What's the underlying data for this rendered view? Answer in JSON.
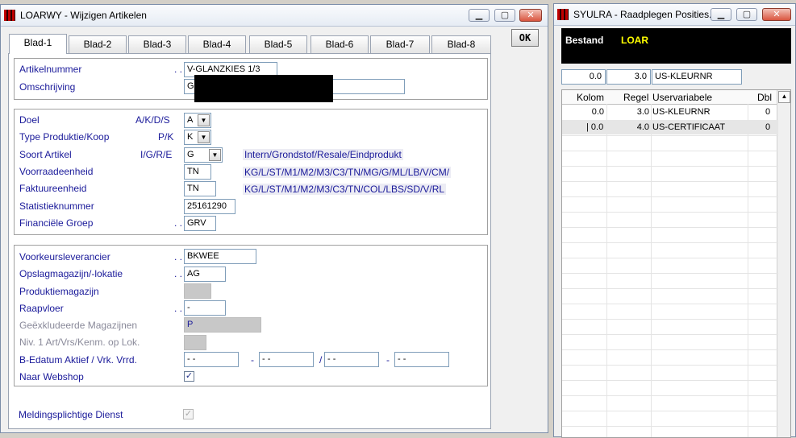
{
  "main_window": {
    "title": "LOARWY - Wijzigen Artikelen",
    "ok_label": "OK",
    "tabs": [
      {
        "label": "Blad-1"
      },
      {
        "label": "Blad-2"
      },
      {
        "label": "Blad-3"
      },
      {
        "label": "Blad-4"
      },
      {
        "label": "Blad-5"
      },
      {
        "label": "Blad-6"
      },
      {
        "label": "Blad-7"
      },
      {
        "label": "Blad-8"
      }
    ],
    "active_tab": "Blad-1",
    "group1": {
      "artikelnummer_label": "Artikelnummer",
      "artikelnummer_value": "V-GLANZKIES 1/3",
      "omschrijving_label": "Omschrijving",
      "omschrijving_value": "G"
    },
    "group2": {
      "doel_label": "Doel",
      "doel_codes": "A/K/D/S",
      "doel_value": "A",
      "type_label": "Type Produktie/Koop",
      "type_codes": "P/K",
      "type_value": "K",
      "soort_label": "Soort Artikel",
      "soort_codes": "I/G/R/E",
      "soort_value": "G",
      "soort_hint": "Intern/Grondstof/Resale/Eindprodukt",
      "voorraad_label": "Voorraadeenheid",
      "voorraad_value": "TN",
      "voorraad_hint": "KG/L/ST/M1/M2/M3/C3/TN/MG/G/ML/LB/V/CM/",
      "faktuur_label": "Faktuureenheid",
      "faktuur_value": "TN",
      "faktuur_hint": "KG/L/ST/M1/M2/M3/C3/TN/COL/LBS/SD/V/RL",
      "statistiek_label": "Statistieknummer",
      "statistiek_value": "25161290",
      "financiele_label": "Financiële Groep",
      "financiele_value": "GRV"
    },
    "group3": {
      "voorkeur_label": "Voorkeursleverancier",
      "voorkeur_value": "BKWEE",
      "opslag_label": "Opslagmagazijn/-lokatie",
      "opslag_value": "AG",
      "produktie_label": "Produktiemagazijn",
      "produktie_value": "",
      "raapvloer_label": "Raapvloer",
      "raapvloer_value": "-",
      "geexcl_label": "Geëxkludeerde Magazijnen",
      "geexcl_value": "P",
      "niv_label": "Niv. 1 Art/Vrs/Kenm. op Lok.",
      "niv_value": "",
      "bedatum_label": "B-Edatum Aktief / Vrk. Vrrd.",
      "date1": "- -",
      "date2": "- -",
      "date3": "- -",
      "date4": "- -",
      "sep1": "-",
      "sep2": "/",
      "sep3": "-",
      "webshop_label": "Naar Webshop",
      "webshop_checked": "✓"
    },
    "group4": {
      "melding_label": "Meldingsplichtige Dienst",
      "melding_checked": "✓"
    }
  },
  "side_window": {
    "title": "SYULRA - Raadplegen Posities...",
    "header": {
      "bestand_label": "Bestand",
      "bestand_value": "LOAR"
    },
    "filter": {
      "kolom": "0.0",
      "regel": "3.0",
      "uservariabele": "US-KLEURNR"
    },
    "grid": {
      "columns": [
        "Kolom",
        "Regel",
        "Uservariabele",
        "Dbl"
      ],
      "rows": [
        {
          "kolom": "0.0",
          "regel": "3.0",
          "uservariabele": "US-KLEURNR",
          "dbl": "0"
        },
        {
          "kolom": "| 0.0",
          "regel": "4.0",
          "uservariabele": "US-CERTIFICAAT",
          "dbl": "0"
        }
      ]
    }
  }
}
